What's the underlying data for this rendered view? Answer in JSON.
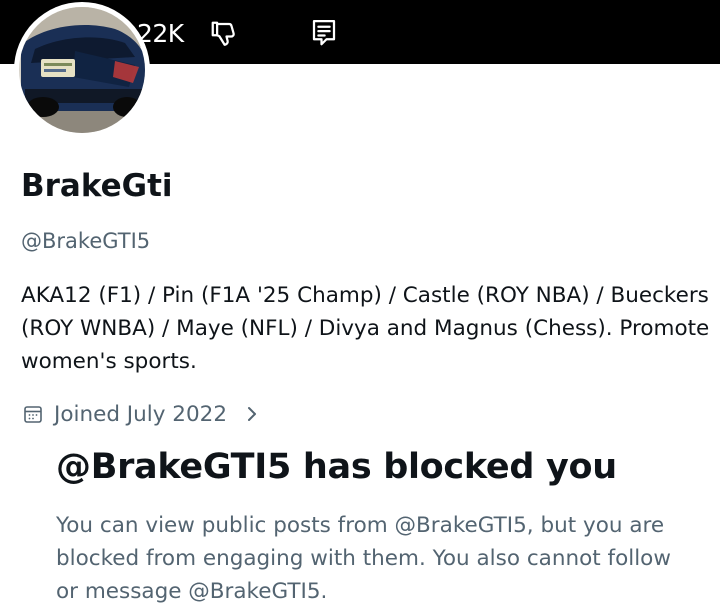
{
  "header": {
    "count": "22K",
    "icons": [
      "thumbs-down-icon",
      "notes-icon"
    ]
  },
  "profile": {
    "display_name": "BrakeGti",
    "handle": "@BrakeGTI5",
    "bio": "AKA12 (F1) / Pin (F1A '25 Champ) / Castle (ROY NBA) / Bueckers (ROY WNBA) / Maye (NFL) / Divya and Magnus (Chess). Promote women's sports.",
    "joined": "Joined July 2022"
  },
  "blocked": {
    "title": "@BrakeGTI5 has blocked you",
    "message": "You can view public posts from @BrakeGTI5, but you are blocked from engaging with them. You also cannot follow or message @BrakeGTI5."
  },
  "colors": {
    "topbar": "#000000",
    "text_primary": "#0f1419",
    "text_secondary": "#536471"
  }
}
